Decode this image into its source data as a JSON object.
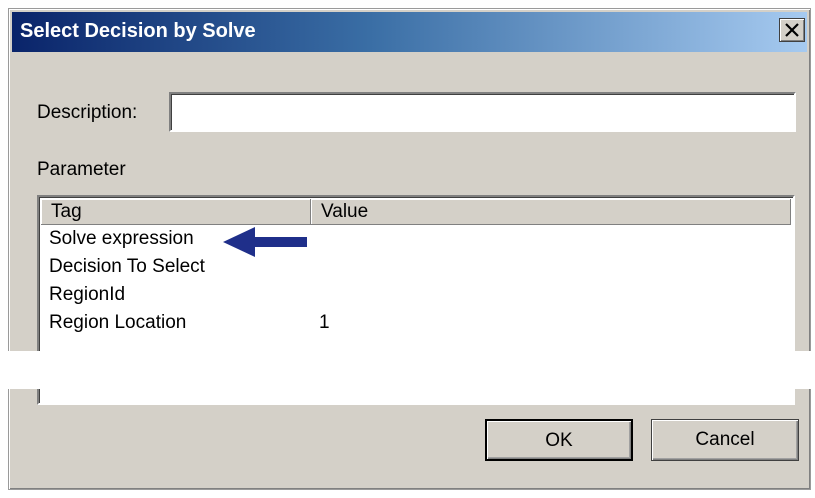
{
  "dialog": {
    "title": "Select Decision by Solve",
    "description_label": "Description:",
    "description_value": "",
    "parameter_label": "Parameter",
    "columns": {
      "tag": "Tag",
      "value": "Value"
    },
    "rows": [
      {
        "tag": "Solve expression",
        "value": ""
      },
      {
        "tag": "Decision To Select",
        "value": ""
      },
      {
        "tag": "RegionId",
        "value": ""
      },
      {
        "tag": "Region Location",
        "value": "1"
      }
    ],
    "ok_label": "OK",
    "cancel_label": "Cancel"
  },
  "colors": {
    "title_gradient_start": "#0a246a",
    "title_gradient_end": "#a6caf0",
    "dialog_bg": "#d4d0c8",
    "arrow": "#1f2f8a"
  },
  "icons": {
    "close": "close-icon",
    "annotation": "arrow-left-icon"
  }
}
